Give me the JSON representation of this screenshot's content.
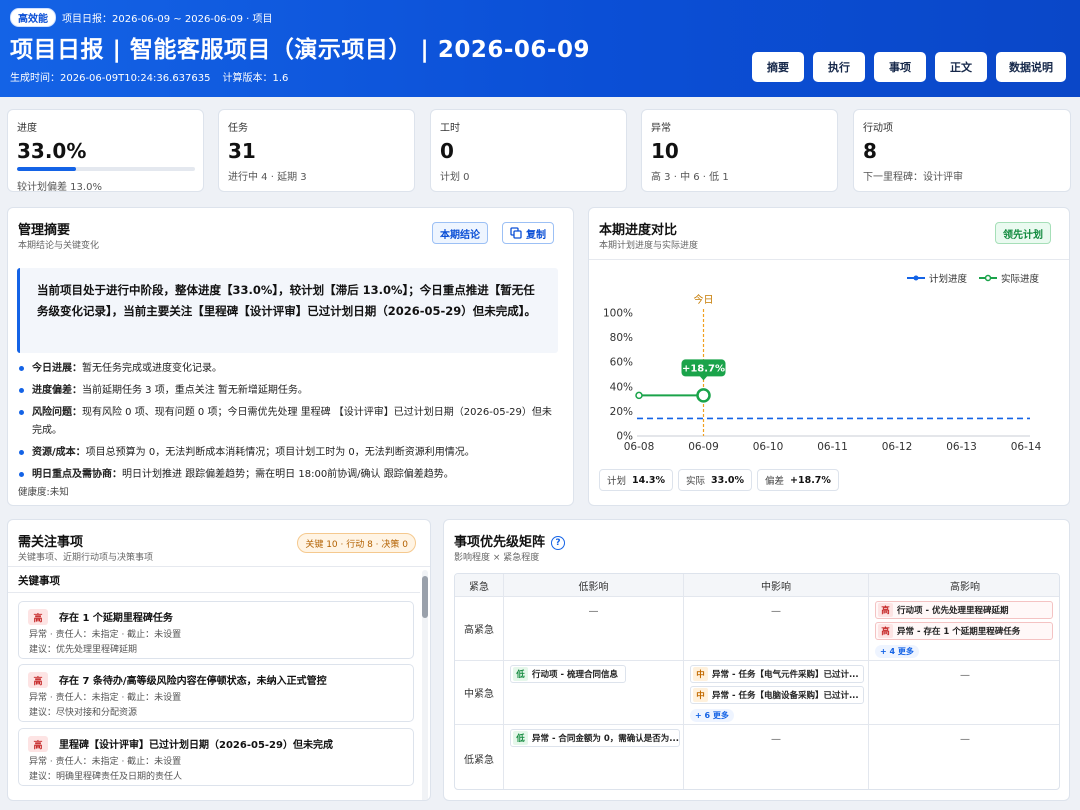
{
  "header": {
    "badge": "高效能",
    "breadcrumb": "项目日报：2026-06-09 ~ 2026-06-09 · 项目",
    "title": "项目日报 | 智能客服项目（演示项目） | 2026-06-09",
    "generated_at": "生成时间：2026-06-09T10:24:36.637635",
    "calc_version": "计算版本：1.6",
    "buttons": [
      "摘要",
      "执行",
      "事项",
      "正文",
      "数据说明"
    ]
  },
  "kpis": [
    {
      "label": "进度",
      "value": "33.0%",
      "sub": "较计划偏差 13.0%",
      "progress_pct": 33.0
    },
    {
      "label": "任务",
      "value": "31",
      "sub": "进行中 4 · 延期 3"
    },
    {
      "label": "工时",
      "value": "0",
      "sub": "计划 0"
    },
    {
      "label": "异常",
      "value": "10",
      "sub": "高 3 · 中 6 · 低 1"
    },
    {
      "label": "行动项",
      "value": "8",
      "sub": "下一里程碑：设计评审"
    }
  ],
  "summary": {
    "title": "管理摘要",
    "subtitle": "本期结论与关键变化",
    "tag": "本期结论",
    "copy_label": "复制",
    "callout": "当前项目处于进行中阶段，整体进度【33.0%】，较计划【滞后 13.0%】；今日重点推进【暂无任务级变化记录】，当前主要关注【里程碑【设计评审】已过计划日期（2026-05-29）但未完成】。",
    "bullets": [
      {
        "k": "今日进展：",
        "v": "暂无任务完成或进度变化记录。"
      },
      {
        "k": "进度偏差：",
        "v": "当前延期任务 3 项，重点关注 暂无新增延期任务。"
      },
      {
        "k": "风险问题：",
        "v": "现有风险 0 项、现有问题 0 项；今日需优先处理 里程碑 【设计评审】已过计划日期（2026-05-29）但未完成。"
      },
      {
        "k": "资源/成本：",
        "v": "项目总预算为 0，无法判断成本消耗情况；项目计划工时为 0，无法判断资源利用情况。"
      },
      {
        "k": "明日重点及需协商：",
        "v": "明日计划推进 跟踪偏差趋势；需在明日 18:00前协调/确认 跟踪偏差趋势。"
      }
    ],
    "health": "健康度:未知"
  },
  "progress": {
    "title": "本期进度对比",
    "subtitle": "本期计划进度与实际进度",
    "tag": "领先计划",
    "legend_plan": "计划进度",
    "legend_actual": "实际进度",
    "today_label": "今日",
    "diff_label": "+18.7%",
    "chips": [
      {
        "k": "计划",
        "v": "14.3%"
      },
      {
        "k": "实际",
        "v": "33.0%"
      },
      {
        "k": "偏差",
        "v": "+18.7%"
      }
    ]
  },
  "chart_data": {
    "type": "line",
    "x": [
      "06-08",
      "06-09",
      "06-10",
      "06-11",
      "06-12",
      "06-13",
      "06-14"
    ],
    "yticks": [
      "0%",
      "20%",
      "40%",
      "60%",
      "80%",
      "100%"
    ],
    "ylim": [
      0,
      100
    ],
    "today": "06-09",
    "series": [
      {
        "name": "计划进度",
        "values": [
          14.3,
          14.3,
          14.3,
          14.3,
          14.3,
          14.3,
          14.3
        ],
        "color": "#1463e6",
        "dashed": true
      },
      {
        "name": "实际进度",
        "values": [
          33.0,
          33.0,
          null,
          null,
          null,
          null,
          null
        ],
        "color": "#1aa34a"
      }
    ],
    "annotation": {
      "x": "06-09",
      "y": 33.0,
      "text": "+18.7%"
    }
  },
  "attention": {
    "title": "需关注事项",
    "subtitle": "关键事项、近期行动项与决策事项",
    "badge": "关键 10 · 行动 8 · 决策 0",
    "section": "关键事项",
    "items": [
      {
        "sev": "高",
        "title": "存在 1 个延期里程碑任务",
        "meta": "异常 · 责任人：未指定 · 截止：未设置",
        "advice": "建议：优先处理里程碑延期"
      },
      {
        "sev": "高",
        "title": "存在 7 条待办/高等级风险内容在停顿状态，未纳入正式管控",
        "meta": "异常 · 责任人：未指定 · 截止：未设置",
        "advice": "建议：尽快对接和分配资源"
      },
      {
        "sev": "高",
        "title": "里程碑【设计评审】已过计划日期（2026-05-29）但未完成",
        "meta": "异常 · 责任人：未指定 · 截止：未设置",
        "advice": "建议：明确里程碑责任及日期的责任人"
      }
    ]
  },
  "matrix": {
    "title": "事项优先级矩阵",
    "help": "?",
    "subtitle": "影响程度 × 紧急程度",
    "corner": "紧急",
    "cols": [
      "低影响",
      "中影响",
      "高影响"
    ],
    "rows": [
      "高紧急",
      "中紧急",
      "低紧急"
    ],
    "empty": "—",
    "cells": {
      "high_high": [
        {
          "lv": "高",
          "text": "行动项 - 优先处理里程碑延期"
        },
        {
          "lv": "高",
          "text": "异常 - 存在 1 个延期里程碑任务"
        }
      ],
      "high_high_more": "+ 4 更多",
      "mid_low": [
        {
          "lv": "低",
          "text": "行动项 - 梳理合同信息"
        }
      ],
      "mid_mid": [
        {
          "lv": "中",
          "text": "异常 - 任务【电气元件采购】已过计..."
        },
        {
          "lv": "中",
          "text": "异常 - 任务【电脑设备采购】已过计..."
        }
      ],
      "mid_mid_more": "+ 6 更多",
      "low_low": [
        {
          "lv": "低",
          "text": "异常 - 合同金额为 0，需确认是否为..."
        }
      ]
    }
  }
}
